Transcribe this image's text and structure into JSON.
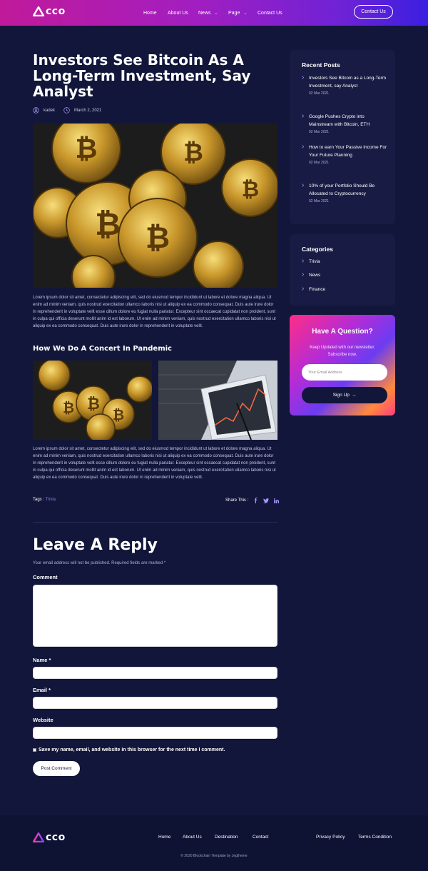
{
  "header": {
    "logo_text": "cco",
    "nav": [
      "Home",
      "About Us",
      "News",
      "Page",
      "Contact Us"
    ],
    "contact_button": "Contact Us"
  },
  "post": {
    "title": "Investors See Bitcoin As A Long-Term Investment, Say Analyst",
    "author": "kadek",
    "date": "March 2, 2021",
    "paragraph1": "Lorem ipsum dolor sit amet, consectetur adipiscing elit, sed do eiusmod tempor incididunt ut labore et dolore magna aliqua. Ut enim ad minim veniam, quis nostrud exercitation ullamco laboris nisi ut aliquip ex ea commodo consequat. Duis aute irure dolor in reprehenderit in voluptate velit esse cillum dolore eu fugiat nulla pariatur. Excepteur sint occaecat cupidatat non proident, sunt in culpa qui officia deserunt mollit anim id est laborum. Ut enim ad minim veniam, quis nostrud exercitation ullamco laboris nisi ut aliquip ex ea commodo consequat. Duis aute irure dolor in reprehenderit in voluptate velit.",
    "subheading": "How We Do A Concert In Pandemic",
    "paragraph2": "Lorem ipsum dolor sit amet, consectetur adipiscing elit, sed do eiusmod tempor incididunt ut labore et dolore magna aliqua. Ut enim ad minim veniam, quis nostrud exercitation ullamco laboris nisi ut aliquip ex ea commodo consequat. Duis aute irure dolor in reprehenderit in voluptate velit esse cillum dolore eu fugiat nulla pariatur. Excepteur sint occaecat cupidatat non proident, sunt in culpa qui officia deserunt mollit anim id est laborum. Ut enim ad minim veniam, quis nostrud exercitation ullamco laboris nisi ut aliquip ex ea commodo consequat. Duis aute irure dolor in reprehenderit in voluptate velit.",
    "tags_label": "Tags :",
    "tag": "Trivia",
    "share_label": "Share This :"
  },
  "reply": {
    "heading": "Leave A Reply",
    "note": "Your email address will not be published. Required fields are marked *",
    "comment_label": "Comment",
    "name_label": "Name *",
    "email_label": "Email *",
    "website_label": "Website",
    "checkbox_label": "Save my name, email, and website in this browser for the next time I comment.",
    "submit": "Post Comment"
  },
  "sidebar": {
    "recent_title": "Recent Posts",
    "recent": [
      {
        "title": "Investors See Bitcoin as a Long-Term Investment, say Analyst",
        "date": "02 Mar 2021"
      },
      {
        "title": "Google Pushes Crypto into Mainstream with Bitcoin, ETH",
        "date": "02 Mar 2021"
      },
      {
        "title": "How to earn Your Passive Income For Your Future Planning",
        "date": "02 Mar 2021"
      },
      {
        "title": "10% of your Portfolio Should Be Allocated to Cryptocurrency",
        "date": "02 Mar 2021"
      }
    ],
    "categories_title": "Categories",
    "categories": [
      "Trivia",
      "News",
      "Finance"
    ],
    "question": {
      "title": "Have A Question?",
      "subtitle": "Keep Updated with our newsletter. Subscribe now.",
      "placeholder": "Your Email Address",
      "button": "Sign Up"
    }
  },
  "footer": {
    "logo_text": "cco",
    "nav": [
      "Home",
      "About Us",
      "Destination",
      "Contact"
    ],
    "links": [
      "Privacy Policy",
      "Terms Condition"
    ],
    "copyright": "© 2020 Blockchain Template by Jegtheme"
  },
  "colors": {
    "accent": "#a995ff",
    "background": "#12163a",
    "card": "#181c44"
  }
}
